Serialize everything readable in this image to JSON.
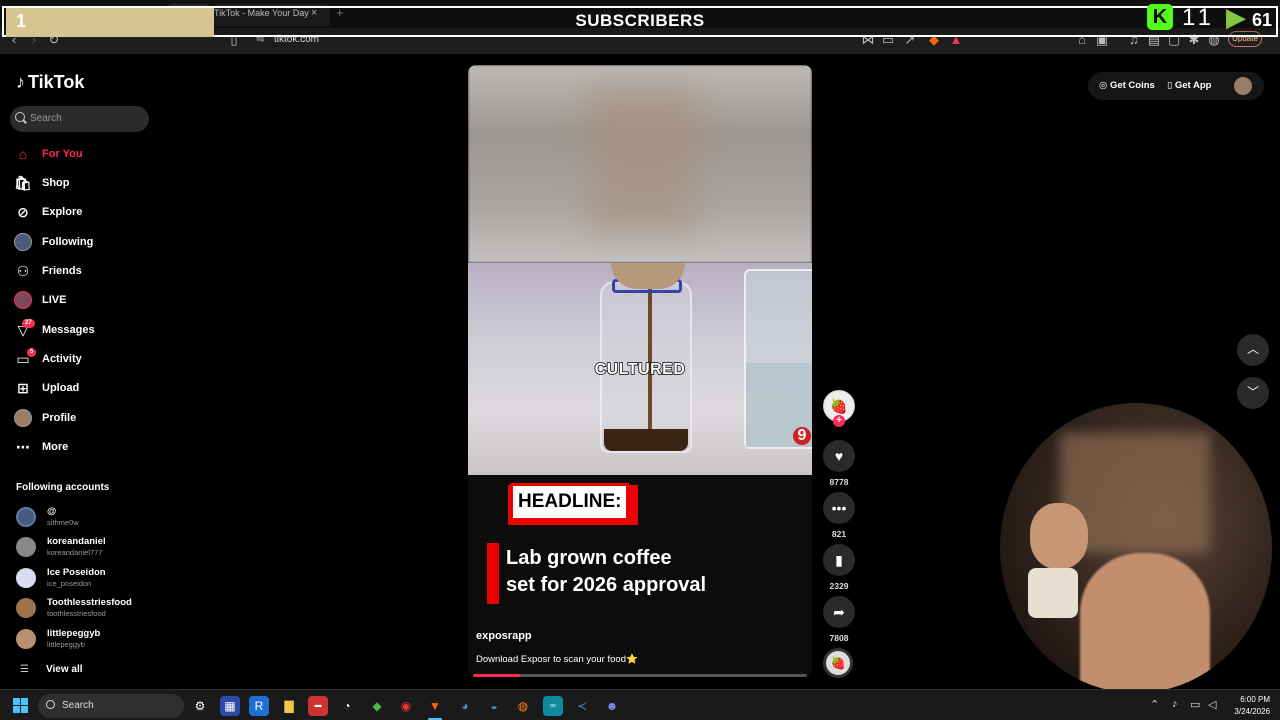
{
  "browser": {
    "tab_title": "TikTok - Make Your Day",
    "url": "tiktok.com",
    "update_label": "Update"
  },
  "overlay": {
    "box_number": "1",
    "title": "SUBSCRIBERS",
    "kick_count": "11",
    "rumble_count": "61"
  },
  "sidebar": {
    "logo": "TikTok",
    "search_placeholder": "Search",
    "nav": [
      {
        "label": "For You",
        "icon": "home-icon"
      },
      {
        "label": "Shop",
        "icon": "shop-icon"
      },
      {
        "label": "Explore",
        "icon": "compass-icon"
      },
      {
        "label": "Following",
        "icon": "avatar-icon"
      },
      {
        "label": "Friends",
        "icon": "friends-icon"
      },
      {
        "label": "LIVE",
        "icon": "live-avatar-icon"
      },
      {
        "label": "Messages",
        "icon": "paper-plane-icon",
        "badge": "27"
      },
      {
        "label": "Activity",
        "icon": "activity-icon",
        "badge": "5"
      },
      {
        "label": "Upload",
        "icon": "upload-icon"
      },
      {
        "label": "Profile",
        "icon": "profile-avatar-icon"
      },
      {
        "label": "More",
        "icon": "ellipsis-icon"
      }
    ],
    "following_header": "Following accounts",
    "following": [
      {
        "name": "@",
        "handle": "sithme0w"
      },
      {
        "name": "koreandaniel",
        "handle": "koreandaniel777"
      },
      {
        "name": "Ice Poseidon",
        "handle": "ice_poseidon"
      },
      {
        "name": "Toothlesstriesfood",
        "handle": "toothlesstriesfood"
      },
      {
        "name": "littlepeggyb",
        "handle": "littlepeggyb"
      }
    ],
    "view_all": "View all"
  },
  "video": {
    "caption_word": "CULTURED",
    "headline_label": "HEADLINE:",
    "story_line1": "Lab grown coffee",
    "story_line2": "set for 2026 approval",
    "author": "exposrapp",
    "description": "Download Exposr to scan your food⭐",
    "progress_percent": 14,
    "likes": "8778",
    "comments": "821",
    "bookmarks": "2329",
    "shares": "7808"
  },
  "header_right": {
    "get_coins": "Get Coins",
    "get_app": "Get App"
  },
  "taskbar": {
    "search_label": "Search",
    "time": "6:00 PM",
    "date": "3/24/2026"
  },
  "colors": {
    "accent": "#fe2c55",
    "kick_green": "#53fc18",
    "taskbar_accent": "#4cc2ff"
  }
}
